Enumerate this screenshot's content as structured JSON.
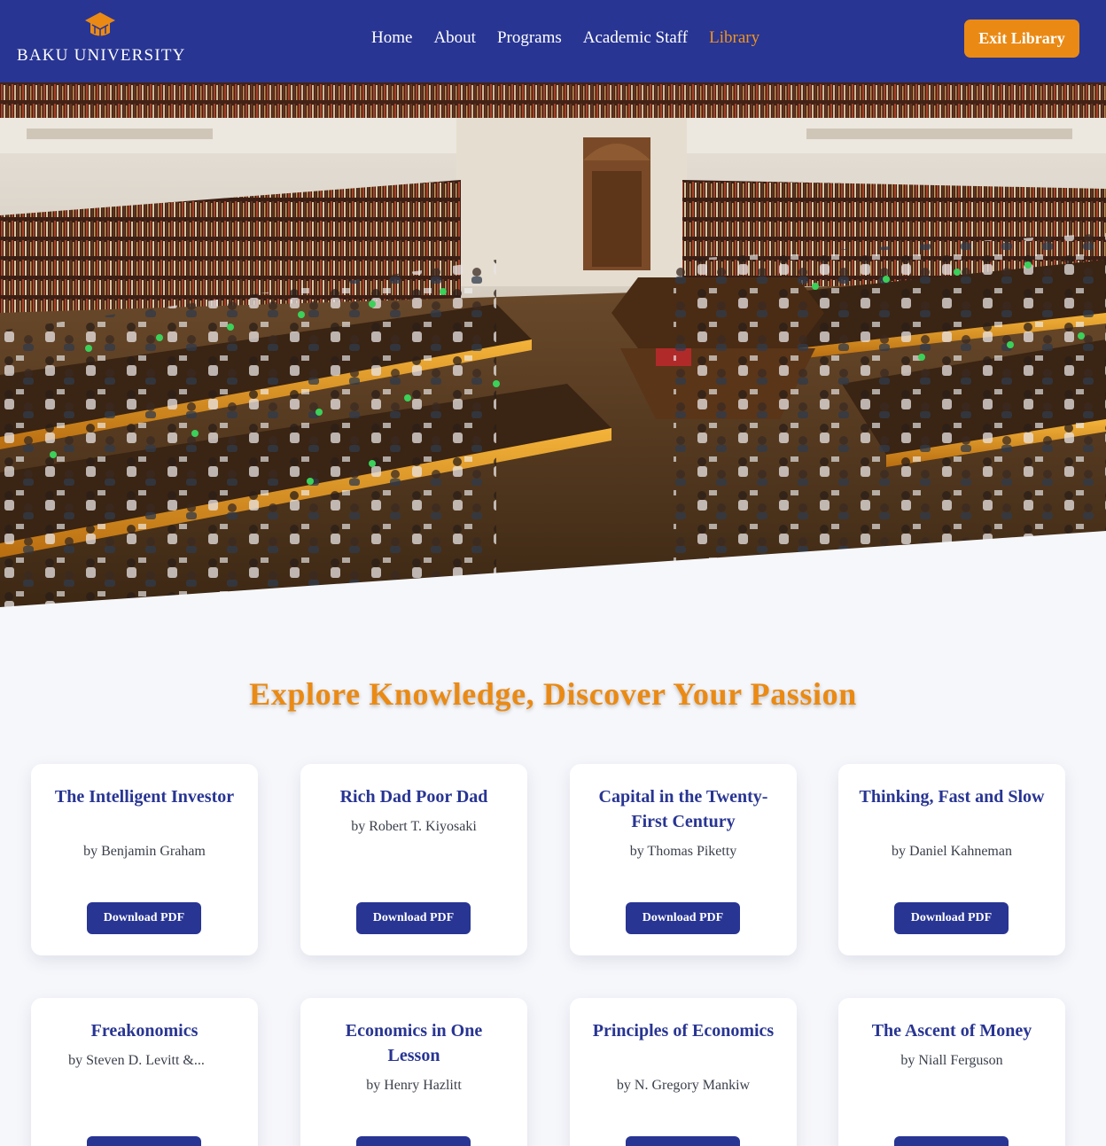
{
  "header": {
    "logo_text": "BAKU UNIVERSITY",
    "nav": [
      "Home",
      "About",
      "Programs",
      "Academic Staff",
      "Library"
    ],
    "active_nav": "Library",
    "exit_label": "Exit Library"
  },
  "hero": {
    "image": "library-reading-room-photo"
  },
  "main": {
    "headline": "Explore Knowledge, Discover Your Passion",
    "download_label": "Download PDF",
    "books": [
      {
        "title": "The Intelligent Investor",
        "author": "by Benjamin Graham"
      },
      {
        "title": "Rich Dad Poor Dad",
        "author": "by Robert T. Kiyosaki"
      },
      {
        "title": "Capital in the Twenty-First Century",
        "author": "by Thomas Piketty"
      },
      {
        "title": "Thinking, Fast and Slow",
        "author": "by Daniel Kahneman"
      },
      {
        "title": "Freakonomics",
        "author": "by Steven D. Levitt &..."
      },
      {
        "title": "Economics in One Lesson",
        "author": "by Henry Hazlitt"
      },
      {
        "title": "Principles of Economics",
        "author": "by N. Gregory Mankiw"
      },
      {
        "title": "The Ascent of Money",
        "author": "by Niall Ferguson"
      }
    ]
  },
  "colors": {
    "primary": "#283593",
    "accent": "#ea8a14",
    "background": "#f6f7fb"
  }
}
